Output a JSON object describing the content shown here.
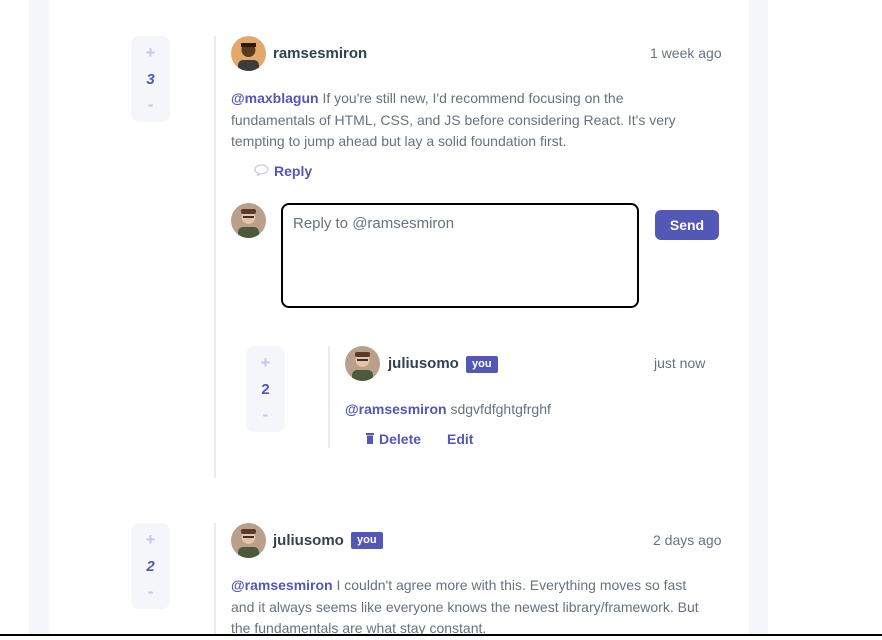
{
  "comments": [
    {
      "score": "3",
      "vote_plus": "+",
      "vote_minus": "-",
      "username": "ramsesmiron",
      "timestamp": "1 week ago",
      "mention": "@maxblagun",
      "text_line1": " If you're still new, I'd recommend focusing on the",
      "text_line2": "fundamentals of HTML, CSS, and JS before considering React. It's very",
      "text_line3": "tempting to jump ahead but lay a solid foundation first.",
      "reply_label": "Reply"
    },
    {
      "score": "2",
      "vote_plus": "+",
      "vote_minus": "-",
      "username": "juliusomo",
      "badge": "you",
      "timestamp": "just now",
      "mention": "@ramsesmiron",
      "text": " sdgvfdfghtgfrghf",
      "delete_label": "Delete",
      "edit_label": "Edit"
    },
    {
      "score": "2",
      "vote_plus": "+",
      "vote_minus": "-",
      "username": "juliusomo",
      "badge": "you",
      "timestamp": "2 days ago",
      "mention": "@ramsesmiron",
      "text_line1": " I couldn't agree more with this. Everything moves so fast",
      "text_line2": "and it always seems like everyone knows the newest library/framework. But",
      "text_line3": "the fundamentals are what stay constant."
    }
  ],
  "reply_form": {
    "placeholder": "Reply to @ramsesmiron",
    "send_label": "Send"
  },
  "colors": {
    "accent": "#5357b6",
    "text": "#67727e",
    "heading": "#334253"
  },
  "icons": [
    "reply-icon",
    "trash-icon"
  ]
}
